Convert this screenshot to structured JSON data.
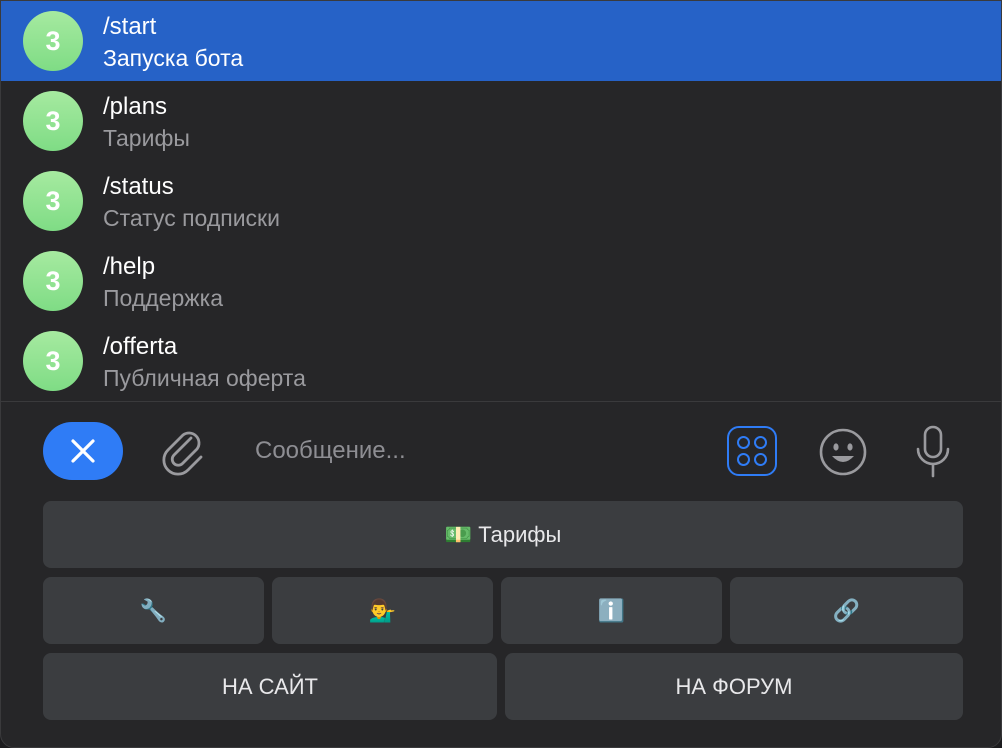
{
  "commands": [
    {
      "avatar": "3",
      "name": "/start",
      "description": "Запуска бота",
      "selected": true
    },
    {
      "avatar": "3",
      "name": "/plans",
      "description": "Тарифы",
      "selected": false
    },
    {
      "avatar": "3",
      "name": "/status",
      "description": "Статус подписки",
      "selected": false
    },
    {
      "avatar": "3",
      "name": "/help",
      "description": "Поддержка",
      "selected": false
    },
    {
      "avatar": "3",
      "name": "/offerta",
      "description": "Публичная оферта",
      "selected": false
    }
  ],
  "composer": {
    "placeholder": "Сообщение...",
    "icons": {
      "close": "close-icon",
      "attach": "paperclip-icon",
      "apps": "bot-keyboard-icon",
      "emoji": "emoji-icon",
      "mic": "microphone-icon"
    }
  },
  "keyboard": {
    "plans": {
      "emoji": "💵",
      "label": "Тарифы"
    },
    "small": [
      {
        "emoji": "🔧",
        "icon": "wrench-icon"
      },
      {
        "emoji": "💁‍♂️",
        "icon": "support-person-icon"
      },
      {
        "emoji": "ℹ️",
        "icon": "info-icon"
      },
      {
        "emoji": "🔗",
        "icon": "link-icon"
      }
    ],
    "site_label": "НА САЙТ",
    "forum_label": "НА ФОРУМ"
  },
  "colors": {
    "accent": "#2f7cf6",
    "selected_row": "#2662c7",
    "panel": "#262628",
    "button": "#3b3d40",
    "avatar_green": "#8fe391"
  }
}
